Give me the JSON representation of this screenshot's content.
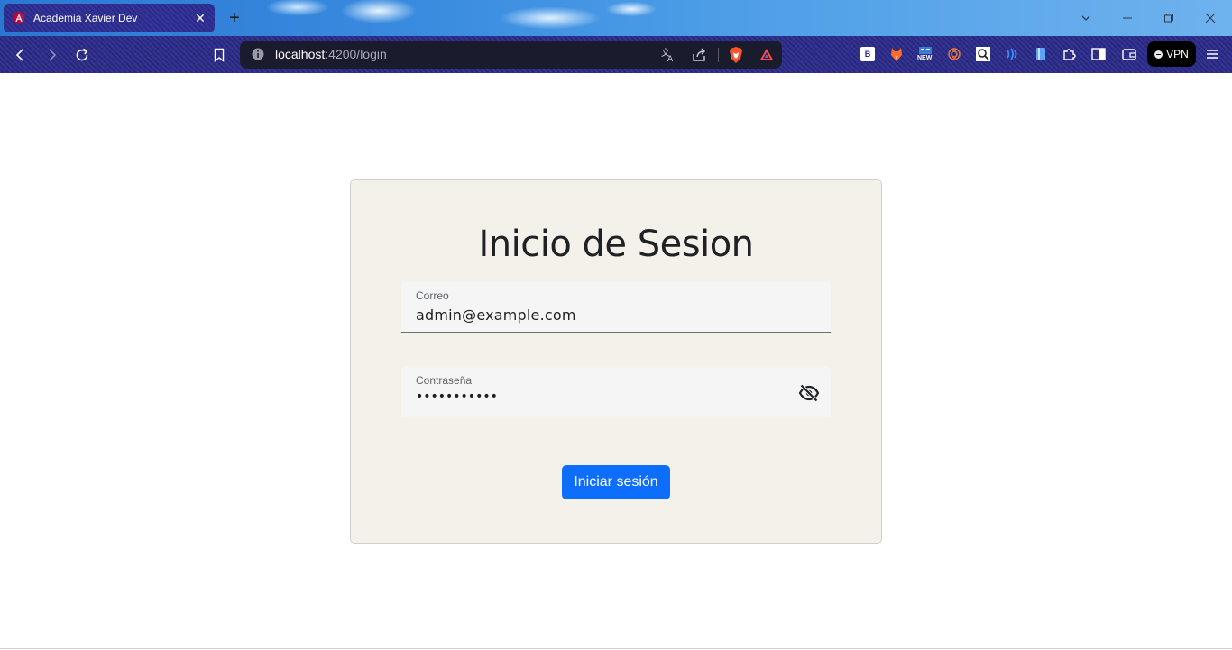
{
  "browser": {
    "tab": {
      "title": "Academia Xavier Dev",
      "close": "✕"
    },
    "new_tab": "+",
    "url": {
      "host": "localhost",
      "path": ":4200/login"
    },
    "vpn_label": "VPN",
    "extensions": [
      "b-ext-icon",
      "fox-ext-icon",
      "new-ext-icon",
      "openai-ext-icon",
      "search-ext-icon",
      "wallet-signal-icon",
      "book-ext-icon",
      "puzzle-icon",
      "sidebar-icon",
      "wallet-icon"
    ],
    "ext_new_label": "NEW",
    "ext_b_label": "B"
  },
  "login": {
    "title": "Inicio de Sesion",
    "email_label": "Correo",
    "email_value": "admin@example.com",
    "password_label": "Contraseña",
    "password_value": "•••••••••••",
    "submit_label": "Iniciar sesión"
  },
  "colors": {
    "accent": "#0d6efd",
    "card_bg": "#f4f1ea",
    "toolbar": "#29298a"
  }
}
